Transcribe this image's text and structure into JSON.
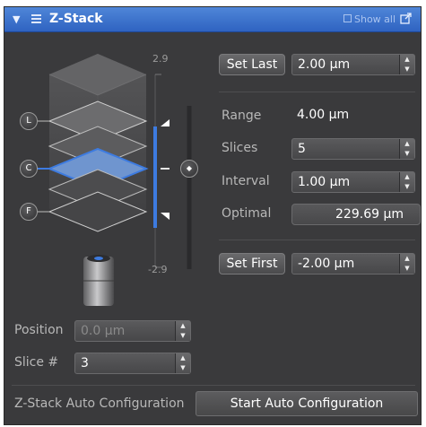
{
  "window": {
    "title": "Z-Stack",
    "show_all": "Show all"
  },
  "stack_view": {
    "top_label": "2.9",
    "bottom_label": "-2.9",
    "markers": {
      "last": "L",
      "center": "C",
      "first": "F"
    }
  },
  "set_last": {
    "button_label": "Set Last",
    "value": "2.00 µm"
  },
  "range": {
    "label": "Range",
    "value": "4.00 µm"
  },
  "slices": {
    "label": "Slices",
    "value": "5"
  },
  "interval": {
    "label": "Interval",
    "value": "1.00 µm"
  },
  "optimal": {
    "label": "Optimal",
    "value": "229.69 µm"
  },
  "set_first": {
    "button_label": "Set First",
    "value": "-2.00 µm"
  },
  "position": {
    "label": "Position",
    "value": "0.0 µm"
  },
  "slice_num": {
    "label": "Slice #",
    "value": "3"
  },
  "auto_config": {
    "label": "Z-Stack Auto Configuration",
    "button_label": "Start Auto Configuration"
  },
  "colors": {
    "title_bar": "#3a72cf",
    "panel_background": "#3a3a3c",
    "accent_blue": "#3d7be0"
  }
}
